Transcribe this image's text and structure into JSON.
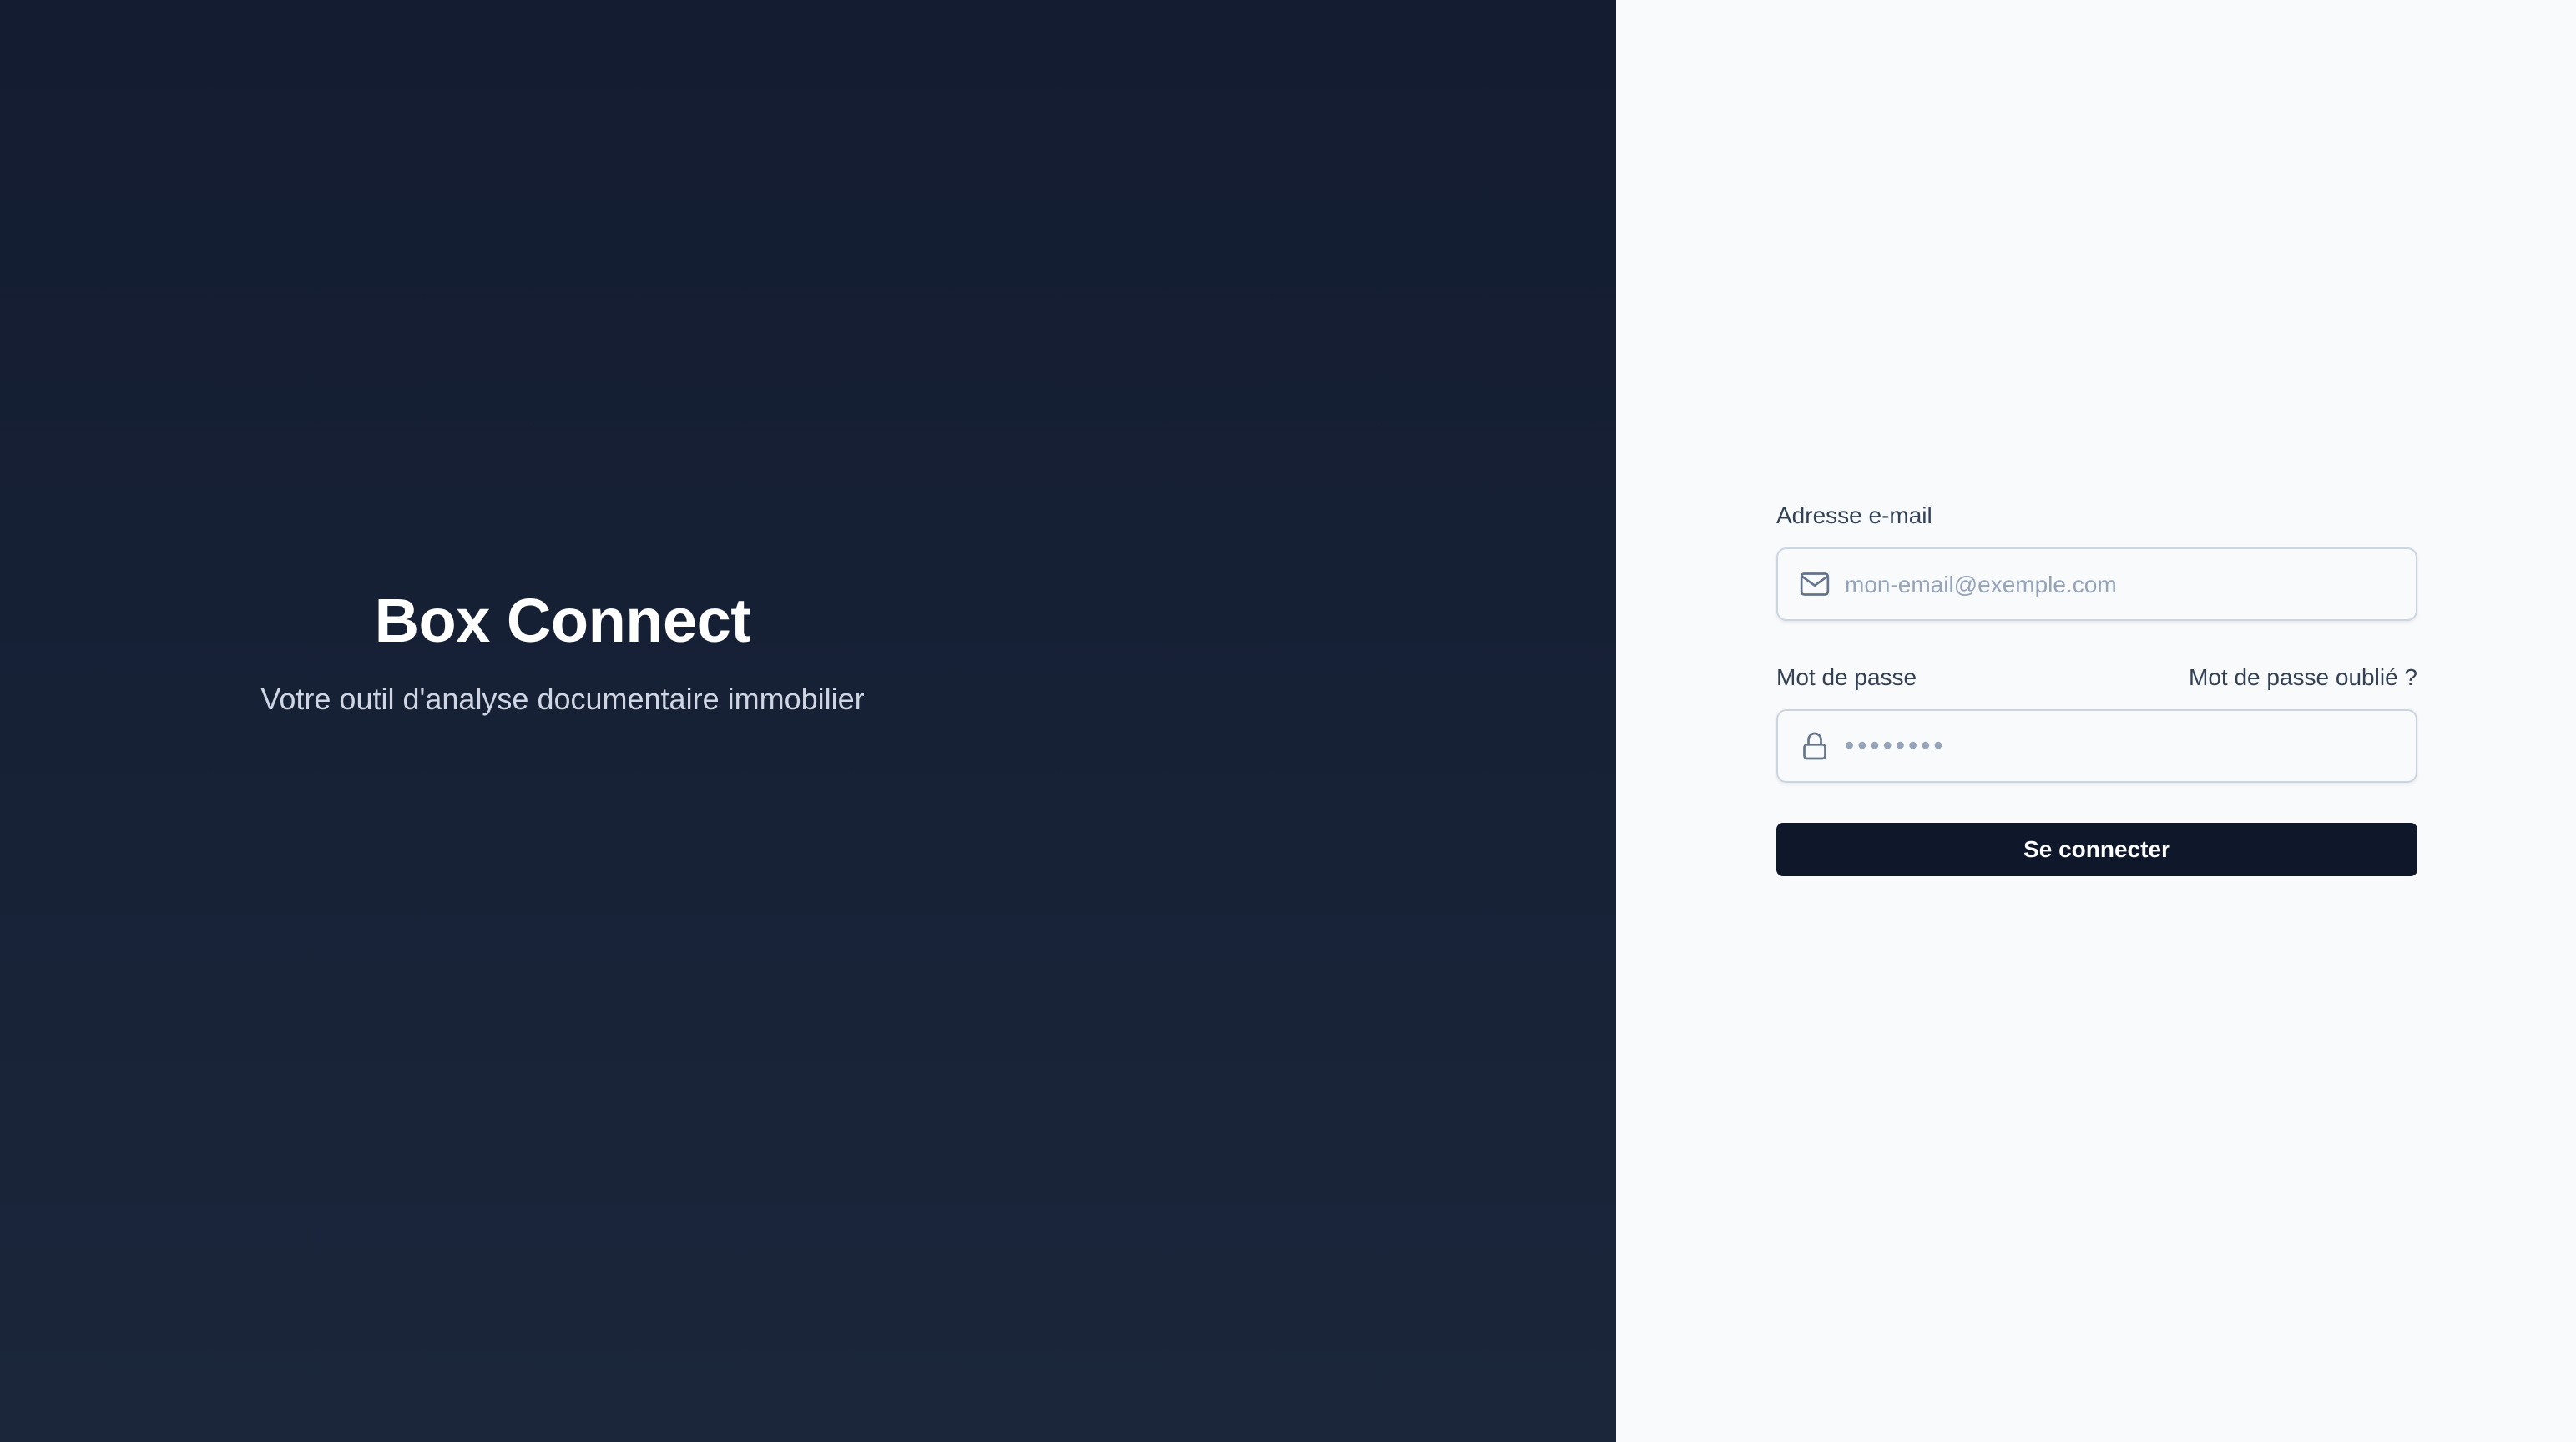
{
  "hero": {
    "title": "Box Connect",
    "subtitle": "Votre outil d'analyse documentaire immobilier"
  },
  "login": {
    "email": {
      "label": "Adresse e-mail",
      "placeholder": "mon-email@exemple.com",
      "value": "",
      "icon": "mail-icon"
    },
    "password": {
      "label": "Mot de passe",
      "placeholder": "••••••••",
      "value": "",
      "icon": "lock-icon",
      "forgot_label": "Mot de passe oublié ?"
    },
    "submit_label": "Se connecter"
  },
  "colors": {
    "hero_background": "#151f33",
    "panel_background": "#f8fafc",
    "button_background": "#0f172a",
    "label_text": "#334155",
    "placeholder_text": "#94a3b8"
  }
}
